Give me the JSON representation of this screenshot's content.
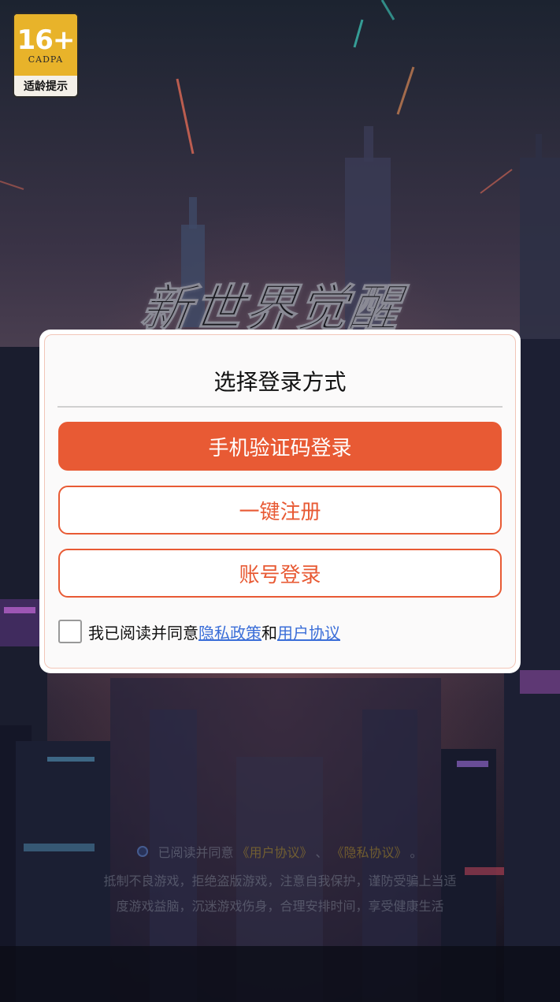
{
  "age_badge": {
    "rating": "16+",
    "org": "CADPA",
    "label": "适龄提示"
  },
  "game_logo": {
    "text": "新世界觉醒"
  },
  "dialog": {
    "title": "选择登录方式",
    "buttons": {
      "phone_login": "手机验证码登录",
      "one_click_register": "一键注册",
      "account_login": "账号登录"
    },
    "agreement": {
      "prefix": "我已阅读并同意",
      "privacy_link": "隐私政策",
      "and": "和",
      "user_link": "用户协议"
    }
  },
  "footer": {
    "agree_prefix": "已阅读并同意",
    "user_agreement": "《用户协议》",
    "sep": "、",
    "privacy_policy": "《隐私协议》",
    "end": "。",
    "notice_line1": "抵制不良游戏，拒绝盗版游戏，注意自我保护，谨防受骗上当适",
    "notice_line2": "度游戏益脑，沉迷游戏伤身，合理安排时间，享受健康生活"
  },
  "colors": {
    "accent": "#e85a34",
    "link": "#3b6ed8",
    "badge_gold": "#e8b32a"
  }
}
